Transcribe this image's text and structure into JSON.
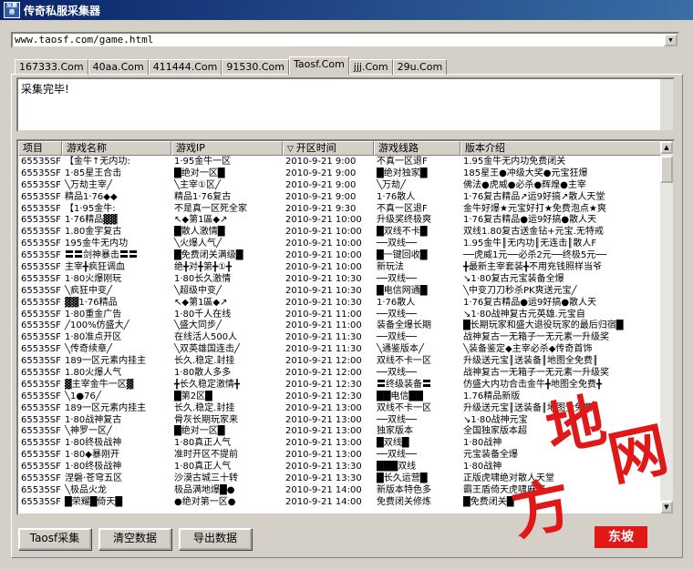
{
  "window": {
    "title": "传奇私服采集器",
    "icon_text": "采集器"
  },
  "url_input": {
    "value": "www.taosf.com/game.html"
  },
  "tabs": [
    "167333.Com",
    "40aa.Com",
    "411444.Com",
    "91530.Com",
    "Taosf.Com",
    "jjj.Com",
    "29u.Com"
  ],
  "active_tab": "Taosf.Com",
  "log": {
    "text": "采集完毕!"
  },
  "table": {
    "columns": [
      "项目",
      "游戏名称",
      "游戏IP",
      "开区时间",
      "游戏线路",
      "版本介绍"
    ],
    "rows": [
      [
        "65535SF",
        "【金牛↑无内功:",
        "1·95金牛一区",
        "2010-9-21 9:00",
        "不真一区退F",
        "1.95金牛无内功免费闭关"
      ],
      [
        "65535SF",
        "1·85星王合击",
        "█绝对一区█",
        "2010-9-21 9:00",
        "█绝对独家█",
        "185星王●冲级大奖●元宝狂爆"
      ],
      [
        "65535SF",
        "╲万劫主宰╱",
        "╲主宰①区╱",
        "2010-9-21 9:00",
        "╲万劫╱",
        "佛法●虎威●必杀●辉煌●主宰"
      ],
      [
        "65535SF",
        "精品1·76◆◆",
        "精品1·76复古",
        "2010-9-21 9:00",
        "1·76散人",
        "1·76复古精品↗运9好搞↗散人天堂"
      ],
      [
        "65535SF",
        "【1·95金牛:",
        "不是真一区死全家",
        "2010-9-21 9:30",
        "不真一区退F",
        "金牛好爆★元宝好打★免费泡点★爽"
      ],
      [
        "65535SF",
        "1·76精品▓▓",
        "↖◆第1區◆↗",
        "2010-9-21 10:00",
        "升级奖终极爽",
        "1·76复古精品●运9好搞●散人天"
      ],
      [
        "65535SF",
        "1.80金宇复古",
        "█散人激情█",
        "2010-9-21 10:00",
        "█双线不卡█",
        "双线1.80复古送金钻+元宝.无特戒"
      ],
      [
        "65535SF",
        "195金牛无内功",
        "╲火爆人气╱",
        "2010-9-21 10:00",
        "──双线──",
        "1.95金牛║无内功║无连击║散人F"
      ],
      [
        "65535SF",
        "〓〓剑神暴击〓〓",
        "█免费闭关满级█",
        "2010-9-21 10:00",
        "█一键回收█",
        "──虎威1元──必杀2元──终极5元──"
      ],
      [
        "65535SF",
        "主宰╋疯狂调血",
        "绝╋对╋第╋①╋",
        "2010-9-21 10:00",
        "新玩法",
        "╋最新主宰套装╋不用充钱照样当爷"
      ],
      [
        "65535SF",
        "1·80火爆刚玩",
        "1·80长久激情",
        "2010-9-21 10:30",
        "──双线──",
        "↘1·80复古元宝装备全爆"
      ],
      [
        "65535SF",
        "╲疯狂中变╱",
        "╲超级中变╱",
        "2010-9-21 10:30",
        "█电信网通█",
        "╲中变刀刀秒杀PK爽送元宝╱"
      ],
      [
        "65535SF",
        "▓▓1·76精品",
        "↖◆第1區◆↗",
        "2010-9-21 10:30",
        "1·76散人",
        "1·76复古精品●运9好搞●散人天"
      ],
      [
        "65535SF",
        "1·80重金广告",
        "1·80千人在线",
        "2010-9-21 11:00",
        "──双线──",
        "↘1·80战神复古元英雄.元宝自"
      ],
      [
        "65535SF",
        "╱100%仿盛大╱",
        "╲盛大同步╱",
        "2010-9-21 11:00",
        "装备全爆长期",
        "█长期玩家和盛大退役玩家的最后归宿█"
      ],
      [
        "65535SF",
        "1·80准点开区",
        "在线活人500人",
        "2010-9-21 11:30",
        "──双线──",
        "战神复古一无箱子一无元素一升级奖"
      ],
      [
        "65535SF",
        "╲传奇续章╱",
        "╲双英雄国连击╱",
        "2010-9-21 11:30",
        "╲通鉴版本╱",
        "╲装备鉴定◆主宰必杀◆传奇首饰"
      ],
      [
        "65535SF",
        "189一区元素内挂主",
        "长久.稳定.封挂",
        "2010-9-21 12:00",
        "双线不卡一区",
        "升级送元宝║送装备║地图全免费║"
      ],
      [
        "65535SF",
        "1.80火爆人气",
        "1·80散人多多",
        "2010-9-21 12:00",
        "──双线──",
        "战神复古一无箱子一无元素一升级奖"
      ],
      [
        "65535SF",
        "▓主宰金牛一区▓",
        "╋长久稳定激情╋",
        "2010-9-21 12:30",
        "〓终级装备〓",
        "仿盛大内功合击金牛╋地图全免费╋"
      ],
      [
        "65535SF",
        "╲1●76╱",
        "█第2区█",
        "2010-9-21 12:30",
        "██电信██",
        "1.76精品新版"
      ],
      [
        "65535SF",
        "189一区元素内挂主",
        "长久.稳定.封挂",
        "2010-9-21 13:00",
        "双线不卡一区",
        "升级送元宝║送装备║地图全免费"
      ],
      [
        "65535SF",
        "1·80战神复古",
        "骨灰长期玩家来",
        "2010-9-21 13:00",
        "──双线──",
        "↘1·80战神元宝"
      ],
      [
        "65535SF",
        "╲神罗一区╱",
        "█绝对一区█",
        "2010-9-21 13:00",
        "独家版本",
        "全国独家版本超"
      ],
      [
        "65535SF",
        "1·80终极战神",
        "1·80真正人气",
        "2010-9-21 13:00",
        "█双线█",
        "1·80战神"
      ],
      [
        "65535SF",
        "1·80◆暴刚开",
        "准时开区不提前",
        "2010-9-21 13:00",
        "──双线──",
        "元宝装备全爆"
      ],
      [
        "65535SF",
        "1·80终极战神",
        "1·80真正人气",
        "2010-9-21 13:30",
        "███双线",
        "1·80战神"
      ],
      [
        "65535SF",
        "涅磐·苍穹五区",
        "沙漠古城三十转",
        "2010-9-21 13:30",
        "█长久运营█",
        "正版虎啸绝对散人天堂"
      ],
      [
        "65535SF",
        "╲极品火龙",
        "极品满地爆█●",
        "2010-9-21 14:00",
        "新版本特色多",
        "霸王盾倚天虎啸麻痹"
      ],
      [
        "65535SF",
        "█荣耀█倚天█",
        "●绝对第一区●",
        "2010-9-21 14:00",
        "免费闭关修炼",
        "█免费闭关█"
      ]
    ]
  },
  "buttons": {
    "collect": "Taosf采集",
    "clear": "清空数据",
    "export": "导出数据"
  },
  "watermark": {
    "main_top": "地",
    "main_mid": "网",
    "main_left": "方",
    "small": "东坡"
  }
}
